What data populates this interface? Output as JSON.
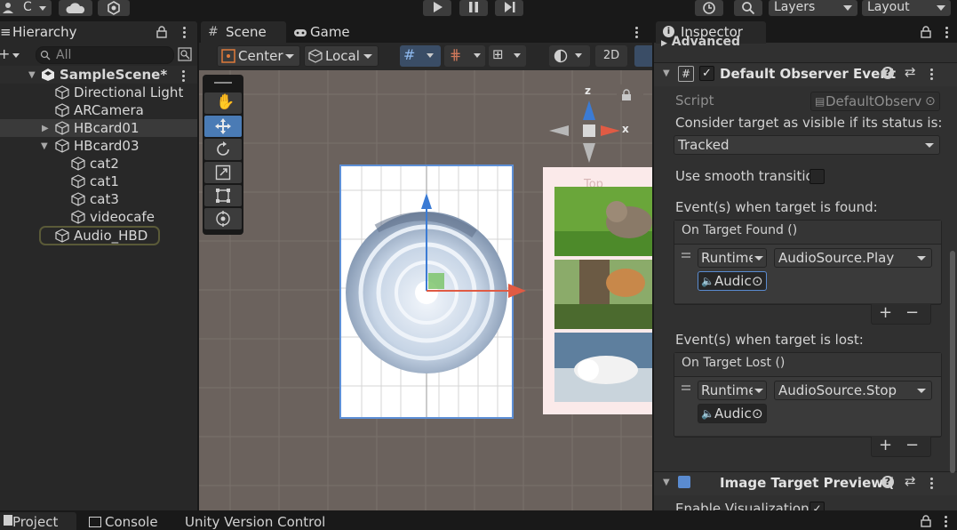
{
  "toolbar": {
    "account_label": "C",
    "layers_label": "Layers",
    "layout_label": "Layout"
  },
  "hierarchy": {
    "tab_label": "Hierarchy",
    "search_placeholder": "All",
    "scene_name": "SampleScene*",
    "items": [
      {
        "label": "Directional Light"
      },
      {
        "label": "ARCamera"
      },
      {
        "label": "HBcard01"
      },
      {
        "label": "HBcard03"
      },
      {
        "label": "cat2"
      },
      {
        "label": "cat1"
      },
      {
        "label": "cat3"
      },
      {
        "label": "videocafe"
      },
      {
        "label": "Audio_HBD"
      }
    ]
  },
  "scene": {
    "tabs": [
      {
        "label": "Scene"
      },
      {
        "label": "Game"
      }
    ],
    "pivot_label": "Center",
    "space_label": "Local",
    "mode_2d_label": "2D",
    "gizmo_z": "z",
    "gizmo_x": "x",
    "view_label": "Top"
  },
  "inspector": {
    "tab_label": "Inspector",
    "advanced_label": "Advanced",
    "component_title": "Default Observer Event",
    "script_label": "Script",
    "script_value": "DefaultObserv",
    "consider_label": "Consider target as visible if its status is:",
    "status_value": "Tracked",
    "smooth_label": "Use smooth transitio",
    "found_label": "Event(s) when target is found:",
    "found_header": "On Target Found ()",
    "found_runtime": "Runtime",
    "found_function": "AudioSource.Play",
    "found_object": "Audic",
    "lost_label": "Event(s) when target is lost:",
    "lost_header": "On Target Lost ()",
    "lost_runtime": "Runtime",
    "lost_function": "AudioSource.Stop",
    "lost_object": "Audic",
    "preview_title": "Image Target Preview (",
    "enable_vis_label": "Enable Visualization"
  },
  "bottom": {
    "tabs": [
      {
        "label": "Project"
      },
      {
        "label": "Console"
      },
      {
        "label": "Unity Version Control"
      }
    ]
  },
  "colors": {
    "accent_blue": "#4a7bb5",
    "selection": "#2c5d87",
    "panel_bg": "#282828",
    "scene_bg": "#6b625d"
  }
}
